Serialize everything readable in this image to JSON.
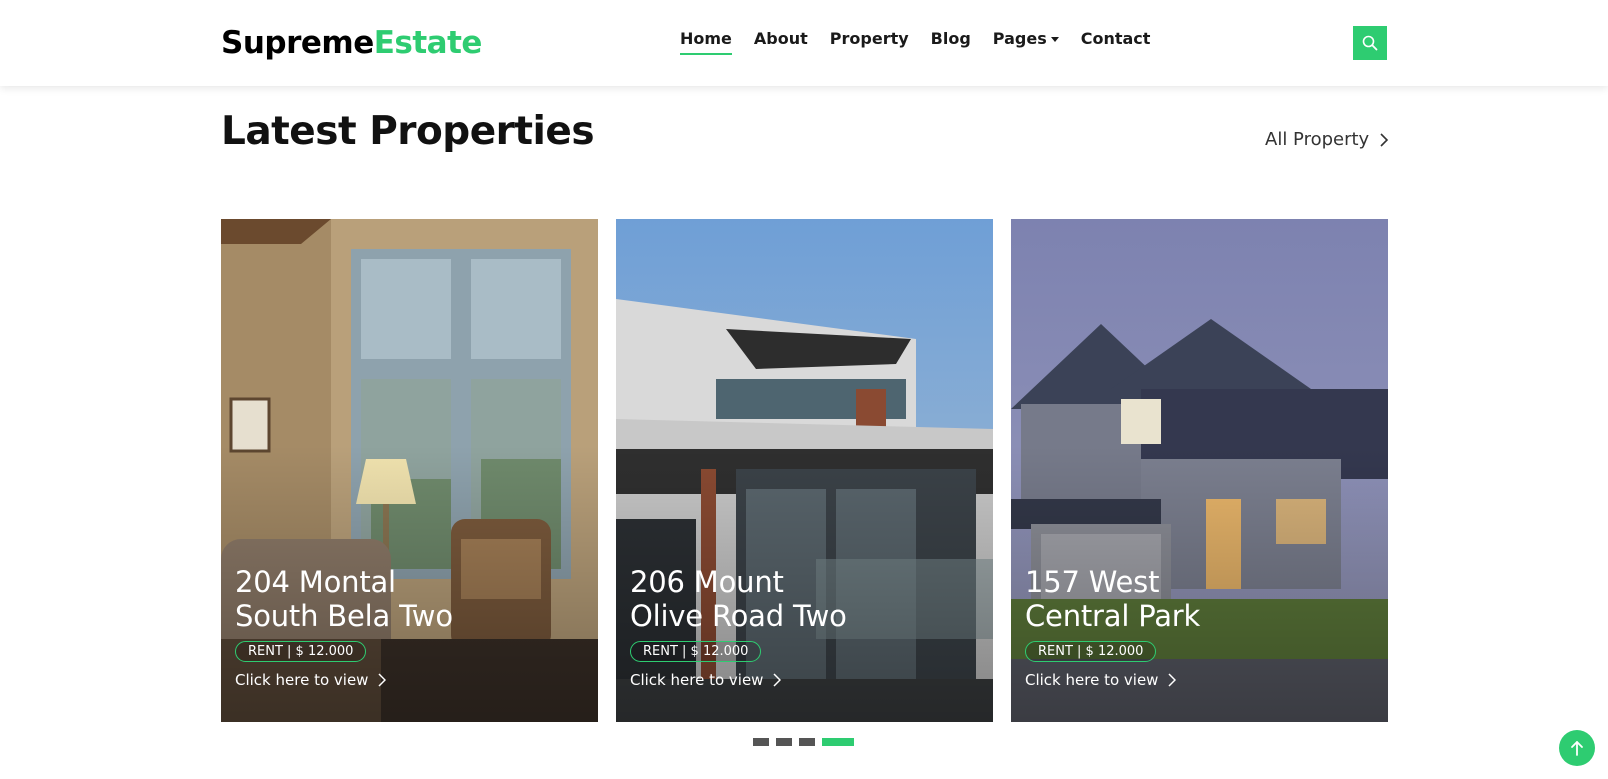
{
  "header": {
    "logo_part1": "Supreme",
    "logo_part2": "Estate",
    "nav": [
      {
        "label": "Home",
        "active": true
      },
      {
        "label": "About"
      },
      {
        "label": "Property"
      },
      {
        "label": "Blog"
      },
      {
        "label": "Pages",
        "dropdown": true
      },
      {
        "label": "Contact"
      }
    ],
    "search_icon": "search-icon"
  },
  "section": {
    "title": "Latest Properties",
    "all_link": "All Property"
  },
  "properties": [
    {
      "line1": "204 Montal",
      "line2": "South Bela Two",
      "badge": "RENT | $ 12.000",
      "cta": "Click here to view"
    },
    {
      "line1": "206 Mount",
      "line2": "Olive Road Two",
      "badge": "RENT | $ 12.000",
      "cta": "Click here to view"
    },
    {
      "line1": "157 West",
      "line2": "Central Park",
      "badge": "RENT | $ 12.000",
      "cta": "Click here to view"
    }
  ],
  "carousel": {
    "pages": 4,
    "active": 4
  },
  "colors": {
    "accent": "#2ecc71",
    "text": "#111111"
  }
}
